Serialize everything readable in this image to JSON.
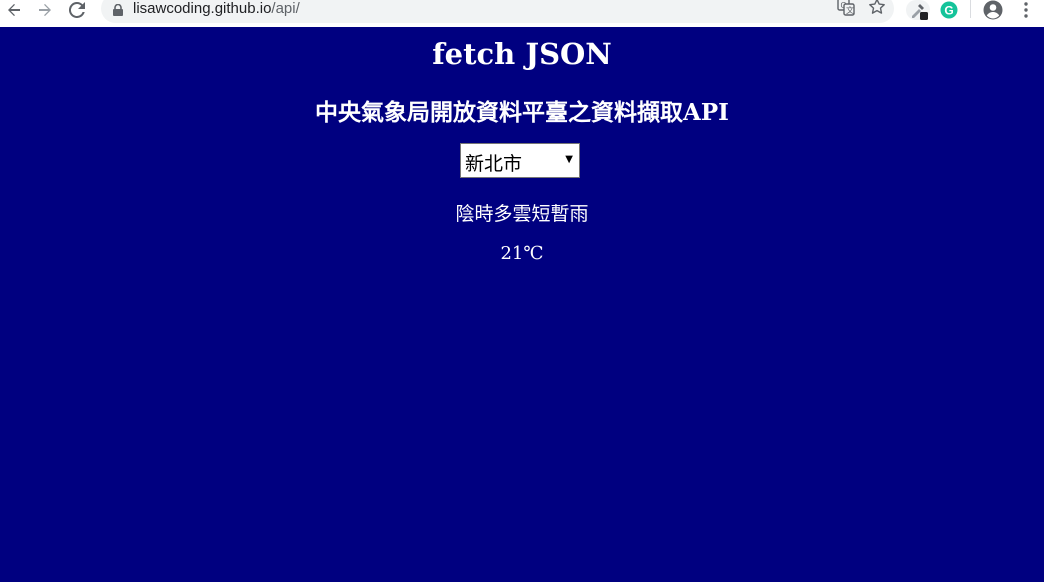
{
  "browser": {
    "url_host": "lisawcoding.github.io",
    "url_path": "/api/"
  },
  "page": {
    "title": "fetch JSON",
    "subtitle": "中央氣象局開放資料平臺之資料擷取API",
    "city_select": {
      "selected": "新北市"
    },
    "weather_description": "陰時多雲短暫雨",
    "temperature": "21℃"
  },
  "colors": {
    "page_background": "#000080",
    "page_text": "#ffffff"
  }
}
